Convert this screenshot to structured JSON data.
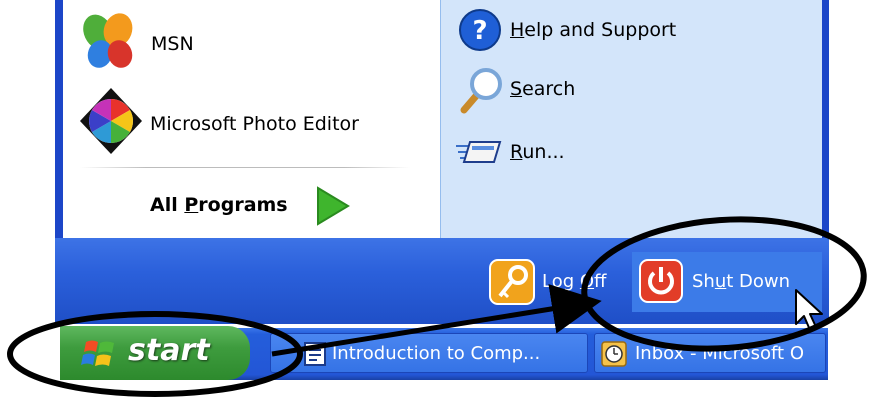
{
  "left_pane": {
    "items": [
      {
        "label": "MSN",
        "icon": "msn-butterfly-icon"
      },
      {
        "label": "Microsoft Photo Editor",
        "icon": "photo-editor-icon"
      }
    ],
    "all_programs": {
      "pre": "All ",
      "accel": "P",
      "post": "rograms",
      "icon": "green-arrow-icon"
    }
  },
  "right_pane": {
    "items": [
      {
        "accel": "H",
        "rest": "elp and Support",
        "icon": "help-icon"
      },
      {
        "accel": "S",
        "rest": "earch",
        "icon": "search-magnifier-icon"
      },
      {
        "accel": "R",
        "rest": "un...",
        "icon": "run-icon"
      }
    ]
  },
  "bottom_bar": {
    "log_off": {
      "pre": "Log ",
      "post": "ff",
      "icon": "key-icon"
    },
    "shut_down": {
      "pre": "Sh",
      "accel": "u",
      "post": "t Down",
      "icon": "power-icon"
    }
  },
  "taskbar": {
    "start_label": "start",
    "tasks": [
      {
        "label": "Introduction to Comp...",
        "icon": "document-icon"
      },
      {
        "label": "Inbox - Microsoft O",
        "icon": "clock-icon"
      }
    ]
  },
  "colors": {
    "start_green": "#3e9c3e",
    "taskbar_blue": "#245edb",
    "right_pane_bg": "#d3e5fa",
    "shut_down_red": "#e23d28",
    "log_off_orange": "#f0a020"
  }
}
